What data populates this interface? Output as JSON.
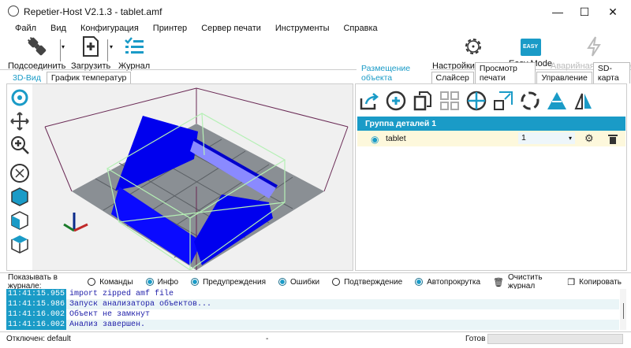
{
  "window": {
    "title": "Repetier-Host V2.1.3 - tablet.amf",
    "minimize": "—",
    "maximize": "☐",
    "close": "✕"
  },
  "menu": [
    "Файл",
    "Вид",
    "Конфигурация",
    "Принтер",
    "Сервер печати",
    "Инструменты",
    "Справка"
  ],
  "toolbar": {
    "connect": "Подсоединить",
    "load": "Загрузить",
    "log": "Журнал",
    "printer_settings": "Настройки принтера",
    "easy_mode": "Easy Mode",
    "easy_badge": "EASY",
    "emergency_stop": "Аварийная остановка"
  },
  "left_tabs": [
    "3D-Вид",
    "График температур"
  ],
  "right_tabs": [
    "Размещение объекта",
    "Слайсер",
    "Просмотр печати",
    "Управление",
    "SD-карта"
  ],
  "objects": {
    "group": "Группа деталей 1",
    "items": [
      {
        "name": "tablet",
        "count": "1"
      }
    ]
  },
  "log_options": {
    "label": "Показывать в журнале:",
    "options": [
      {
        "label": "Команды",
        "checked": false
      },
      {
        "label": "Инфо",
        "checked": true
      },
      {
        "label": "Предупреждения",
        "checked": true
      },
      {
        "label": "Ошибки",
        "checked": true
      },
      {
        "label": "Подтверждение",
        "checked": false
      },
      {
        "label": "Автопрокрутка",
        "checked": true
      }
    ],
    "clear": "Очистить журнал",
    "copy": "Копировать"
  },
  "log": [
    {
      "time": "11:41:15.955",
      "msg": "import zipped amf file"
    },
    {
      "time": "11:41:15.986",
      "msg": "Запуск анализатора объектов..."
    },
    {
      "time": "11:41:16.002",
      "msg": "Объект не замкнут"
    },
    {
      "time": "11:41:16.002",
      "msg": "Анализ завершен."
    }
  ],
  "status": {
    "connection": "Отключен: default",
    "middle": "-",
    "state": "Готов"
  },
  "colors": {
    "accent": "#1a9bc7",
    "object": "#0000ee"
  }
}
